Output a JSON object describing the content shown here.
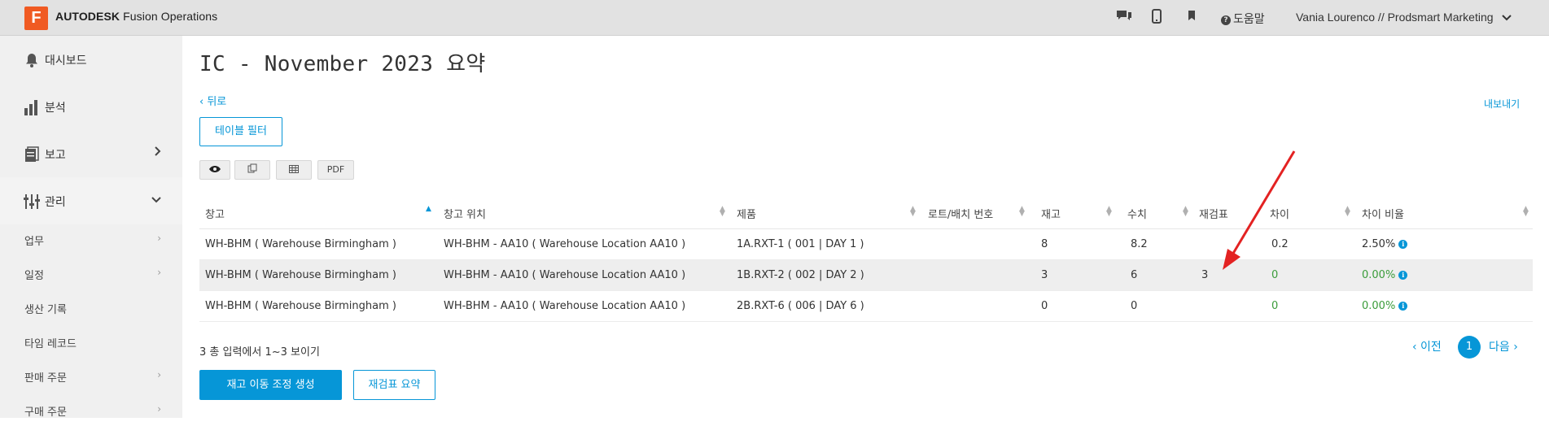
{
  "header": {
    "logo_letter": "F",
    "brand_bold": "AUTODESK",
    "brand_rest": " Fusion Operations",
    "help_label": "도움말",
    "user_label": "Vania Lourenco // Prodsmart Marketing",
    "icons": [
      "chat-icon",
      "mobile-icon",
      "bookmark-icon",
      "help-icon",
      "chevron-down-icon"
    ]
  },
  "sidebar": {
    "main_items": [
      {
        "label": "대시보드",
        "icon": "bell-icon"
      },
      {
        "label": "분석",
        "icon": "bar-chart-icon"
      },
      {
        "label": "보고",
        "icon": "report-icon",
        "arrow": "›"
      },
      {
        "label": "관리",
        "icon": "sliders-icon",
        "arrow": "⌄"
      }
    ],
    "sub_items": [
      {
        "label": "업무",
        "arrow": "›"
      },
      {
        "label": "일정",
        "arrow": "›"
      },
      {
        "label": "생산 기록",
        "arrow": ""
      },
      {
        "label": "타임 레코드",
        "arrow": ""
      },
      {
        "label": "판매 주문",
        "arrow": "›"
      },
      {
        "label": "구매 주문",
        "arrow": "›"
      }
    ]
  },
  "main": {
    "title": "IC - November 2023 요약",
    "back_link": "‹ 뒤로",
    "export_link": "내보내기",
    "filter_button": "테이블 필터",
    "toolbar": {
      "view_icon": "eye-icon",
      "copy_icon": "copy-icon",
      "table_icon": "table-icon",
      "pdf_label": "PDF"
    },
    "table": {
      "columns": [
        "창고",
        "창고 위치",
        "제품",
        "로트/배치 번호",
        "재고",
        "수치",
        "재검표",
        "차이",
        "차이 비율"
      ],
      "sorted_column": "창고",
      "rows": [
        [
          "WH-BHM ( Warehouse Birmingham )",
          "WH-BHM - AA10 ( Warehouse Location AA10 )",
          "1A.RXT-1 ( 001 | DAY 1 )",
          "",
          "8",
          "8.2",
          "",
          "0.2",
          "2.50%"
        ],
        [
          "WH-BHM ( Warehouse Birmingham )",
          "WH-BHM - AA10 ( Warehouse Location AA10 )",
          "1B.RXT-2 ( 002 | DAY 2 )",
          "",
          "3",
          "6",
          "3",
          "0",
          "0.00%"
        ],
        [
          "WH-BHM ( Warehouse Birmingham )",
          "WH-BHM - AA10 ( Warehouse Location AA10 )",
          "2B.RXT-6 ( 006 | DAY 6 )",
          "",
          "0",
          "0",
          "",
          "0",
          "0.00%"
        ]
      ],
      "info_glyph": "i"
    },
    "summary": "3 총 입력에서 1~3 보이기",
    "pagination": {
      "prev": "‹ 이전",
      "current": "1",
      "next": "다음 ›"
    },
    "primary_button": "재고 이동 조정 생성",
    "secondary_button": "재검표 요약"
  },
  "colors": {
    "accent": "#0696d7",
    "brand_orange": "#f05a22",
    "positive_green": "#3a9c3a",
    "annotation_red": "#e32222"
  }
}
